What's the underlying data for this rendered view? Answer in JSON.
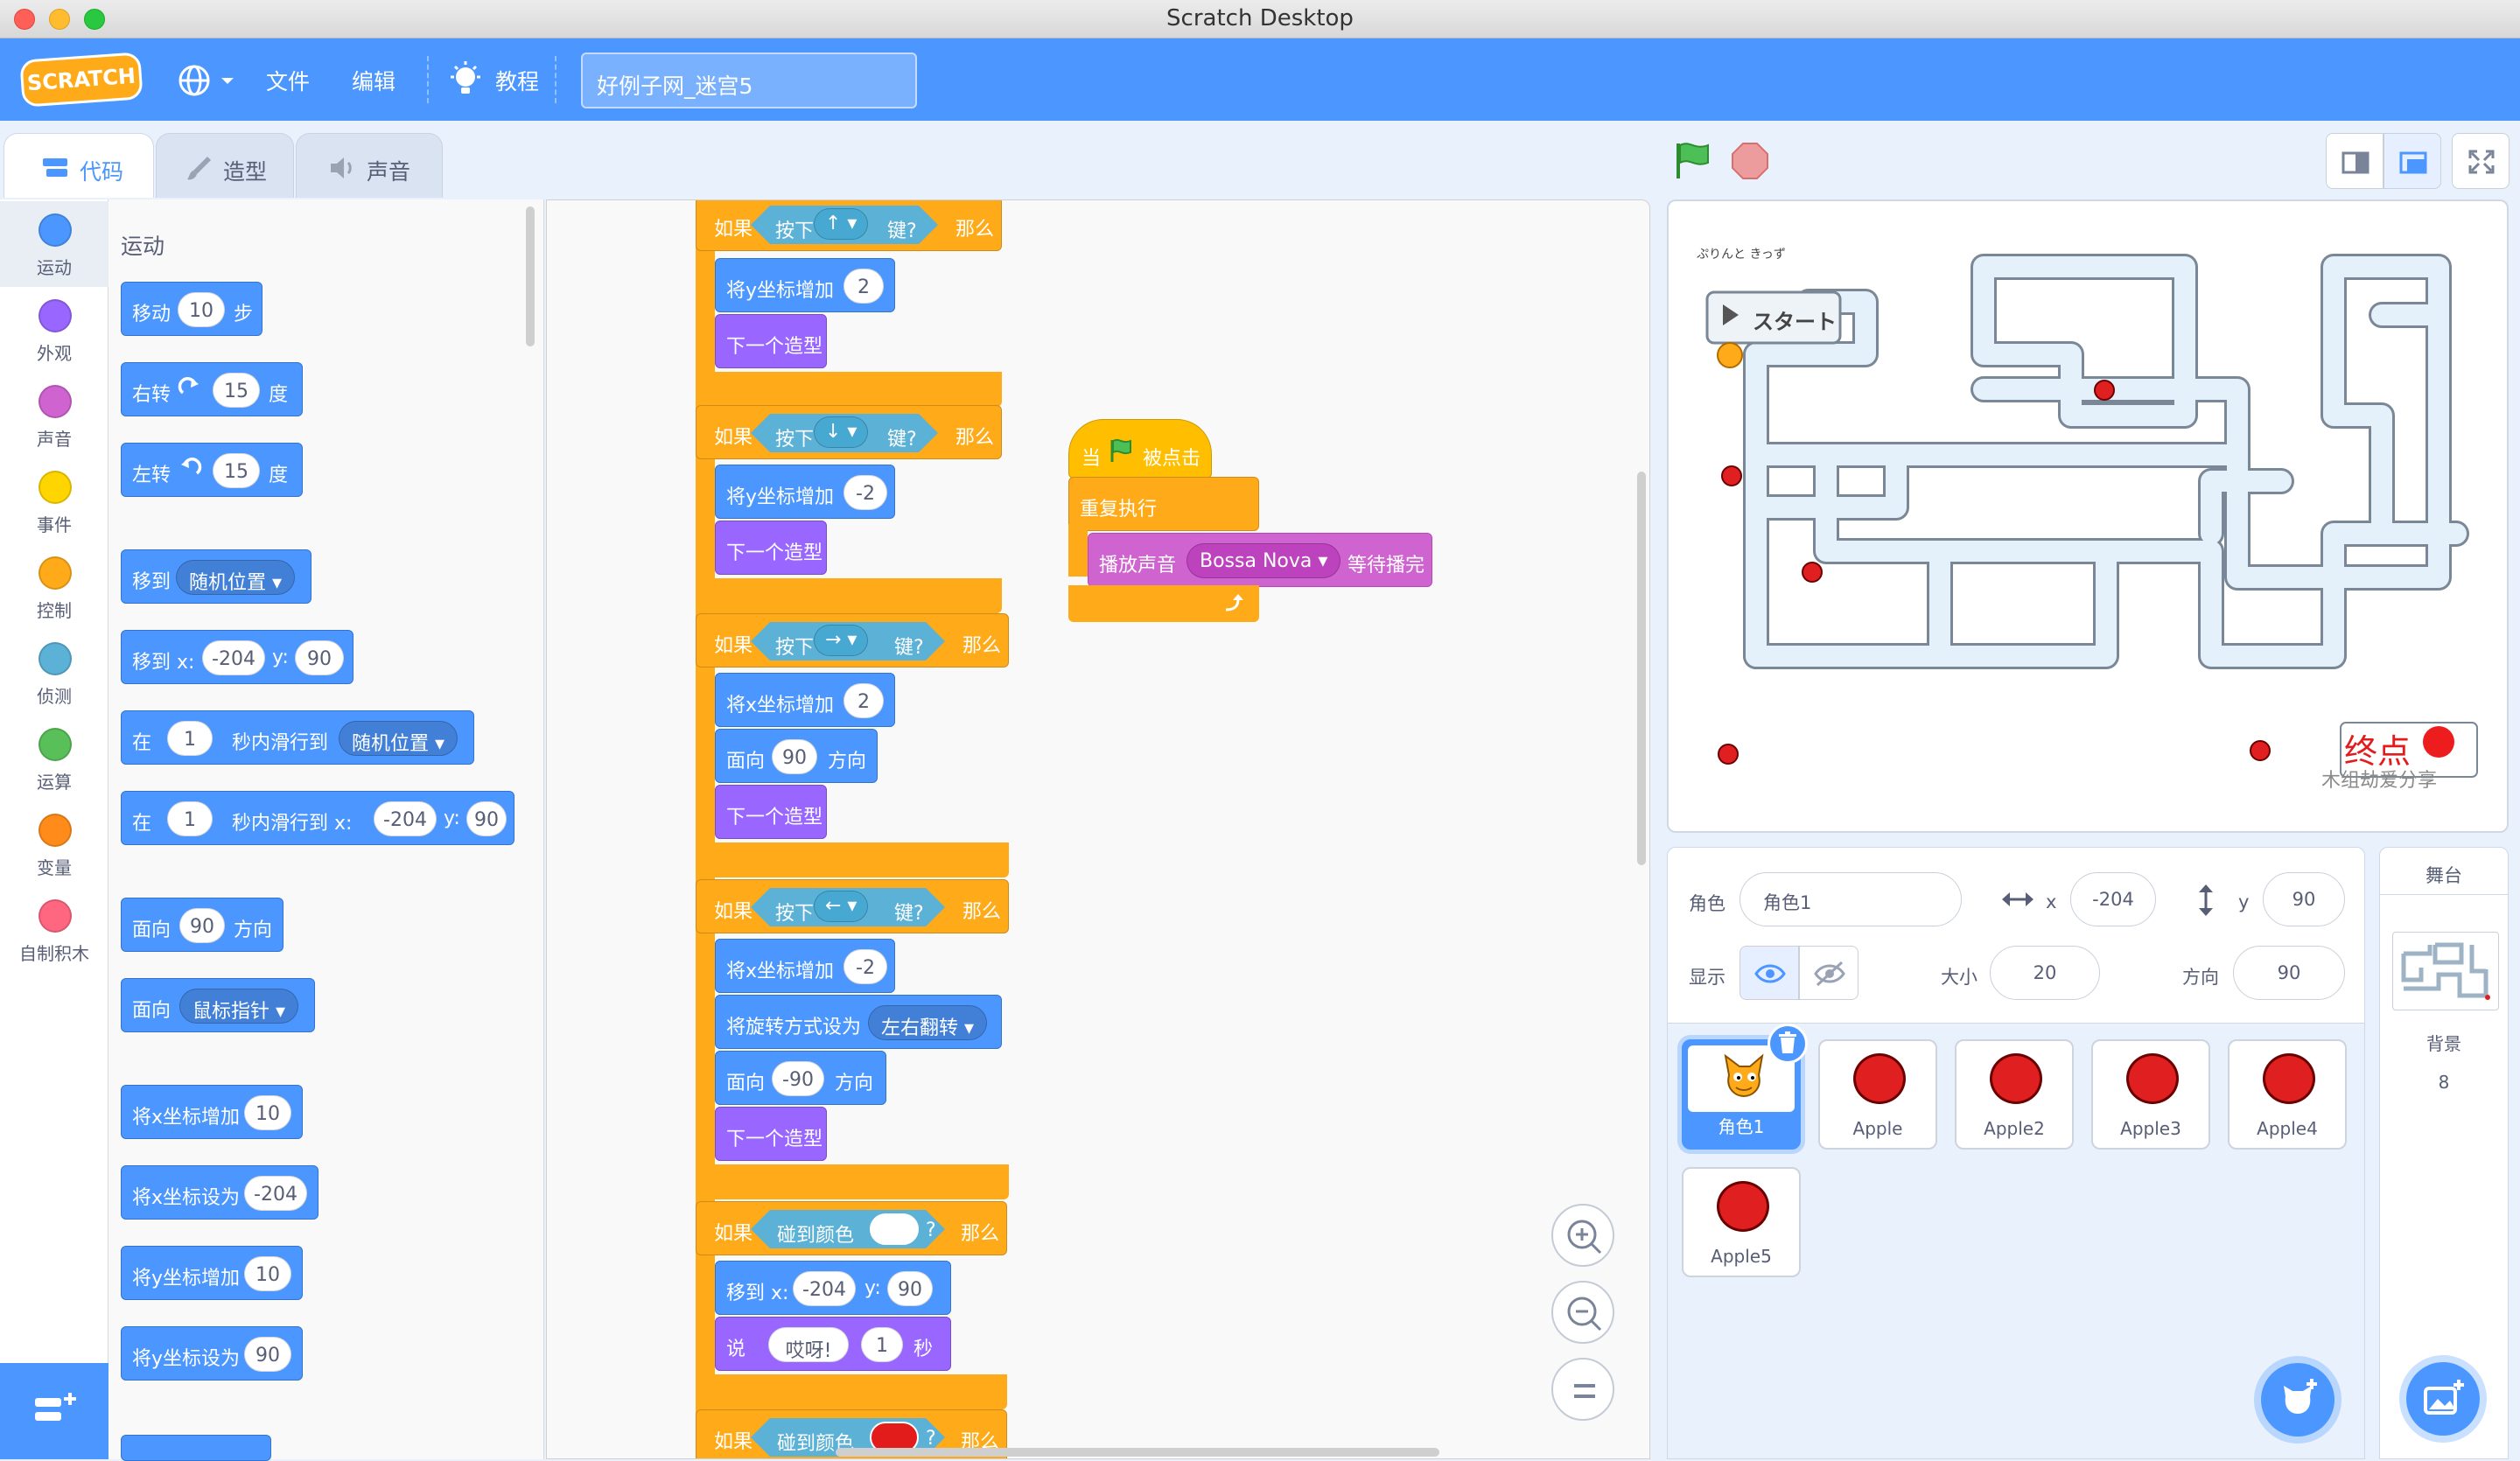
{
  "window": {
    "title": "Scratch Desktop"
  },
  "menubar": {
    "logo": "SCRATCH",
    "file": "文件",
    "edit": "编辑",
    "tutorials": "教程",
    "project_title": "好例子网_迷宫5"
  },
  "tabs": {
    "code": "代码",
    "costumes": "造型",
    "sounds": "声音"
  },
  "categories": [
    "运动",
    "外观",
    "声音",
    "事件",
    "控制",
    "侦测",
    "运算",
    "变量",
    "自制积木"
  ],
  "category_colors": [
    "#4c97ff",
    "#9966ff",
    "#cf63cf",
    "#ffd500",
    "#ffab19",
    "#5cb1d6",
    "#59c059",
    "#ff8c1a",
    "#ff6680"
  ],
  "palette": {
    "section": "运动",
    "move": {
      "a": "移动",
      "v": "10",
      "b": "步"
    },
    "turn_right": {
      "a": "右转",
      "v": "15",
      "b": "度"
    },
    "turn_left": {
      "a": "左转",
      "v": "15",
      "b": "度"
    },
    "goto": {
      "a": "移到",
      "opt": "随机位置"
    },
    "goto_xy": {
      "a": "移到 x:",
      "x": "-204",
      "y_lab": "y:",
      "y": "90"
    },
    "glide": {
      "a": "在",
      "v": "1",
      "b": "秒内滑行到",
      "opt": "随机位置"
    },
    "glide_xy": {
      "a": "在",
      "v": "1",
      "b": "秒内滑行到 x:",
      "x": "-204",
      "y_lab": "y:",
      "y": "90"
    },
    "point_dir": {
      "a": "面向",
      "v": "90",
      "b": "方向"
    },
    "point_towards": {
      "a": "面向",
      "opt": "鼠标指针"
    },
    "change_x": {
      "a": "将x坐标增加",
      "v": "10"
    },
    "set_x": {
      "a": "将x坐标设为",
      "v": "-204"
    },
    "change_y": {
      "a": "将y坐标增加",
      "v": "10"
    },
    "set_y": {
      "a": "将y坐标设为",
      "v": "90"
    }
  },
  "script": {
    "if": "如果",
    "then": "那么",
    "press": "按下",
    "key": "键?",
    "up": "↑",
    "down": "↓",
    "right": "→",
    "left": "←",
    "change_y": "将y坐标增加",
    "change_x": "将x坐标增加",
    "v2": "2",
    "vneg2": "-2",
    "next_costume": "下一个造型",
    "point": "面向",
    "v90": "90",
    "vneg90": "-90",
    "dir": "方向",
    "rot_style": "将旋转方式设为",
    "rot_opt": "左右翻转",
    "touch_color": "碰到颜色",
    "q": "?",
    "goto": "移到 x:",
    "x": "-204",
    "y_lab": "y:",
    "y": "90",
    "say": "说",
    "say_text": "哎呀!",
    "say_secs": "1",
    "secs": "秒"
  },
  "script2": {
    "when": "当",
    "clicked": "被点击",
    "forever": "重复执行",
    "play": "播放声音",
    "sound": "Bossa Nova",
    "until": "等待播完"
  },
  "stage": {
    "start_label": "スタート",
    "end_label": "终点",
    "tiny_text": "ぷりんと きっず",
    "watermark": "木组劫爱分享"
  },
  "sprite_info": {
    "sprite_label": "角色",
    "name": "角色1",
    "x_label": "x",
    "x": "-204",
    "y_label": "y",
    "y": "90",
    "show_label": "显示",
    "size_label": "大小",
    "size": "20",
    "direction_label": "方向",
    "direction": "90"
  },
  "sprites": [
    "角色1",
    "Apple",
    "Apple2",
    "Apple3",
    "Apple4",
    "Apple5"
  ],
  "stage_panel": {
    "title": "舞台",
    "backdrops_label": "背景",
    "backdrop_count": "8"
  }
}
